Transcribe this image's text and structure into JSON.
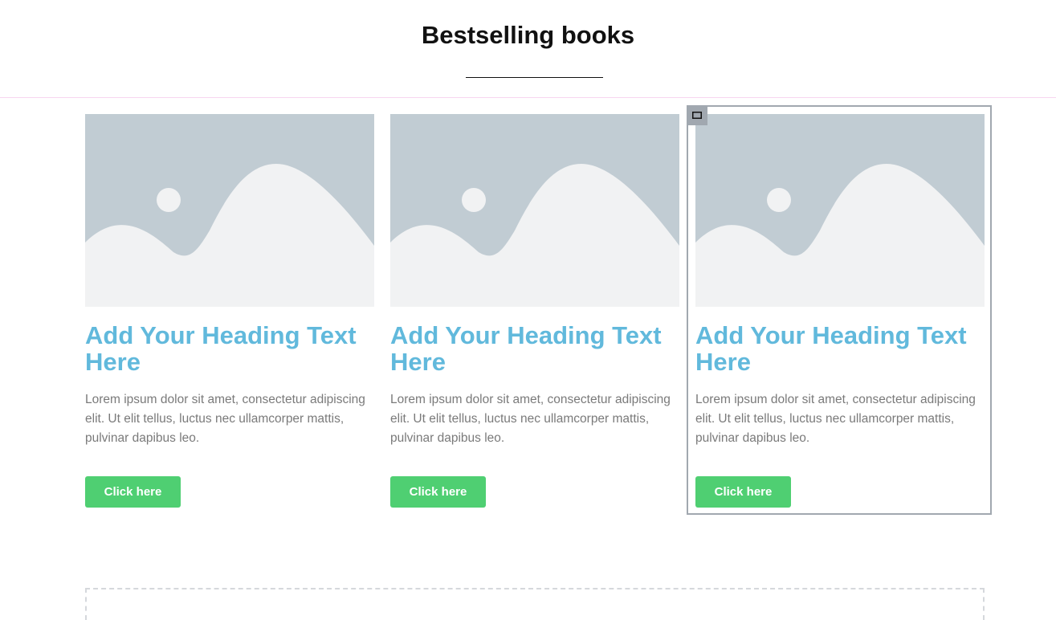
{
  "header": {
    "title": "Bestselling books"
  },
  "cards": [
    {
      "image_icon": "image-placeholder-icon",
      "heading": "Add Your Heading Text Here",
      "text": "Lorem ipsum dolor sit amet, consectetur adipiscing elit. Ut elit tellus, luctus nec ullamcorper mattis, pulvinar dapibus leo.",
      "button_label": "Click here"
    },
    {
      "image_icon": "image-placeholder-icon",
      "heading": "Add Your Heading Text Here",
      "text": "Lorem ipsum dolor sit amet, consectetur adipiscing elit. Ut elit tellus, luctus nec ullamcorper mattis, pulvinar dapibus leo.",
      "button_label": "Click here"
    },
    {
      "image_icon": "image-placeholder-icon",
      "heading": "Add Your Heading Text Here",
      "text": "Lorem ipsum dolor sit amet, consectetur adipiscing elit. Ut elit tellus, luctus nec ullamcorper mattis, pulvinar dapibus leo.",
      "button_label": "Click here"
    }
  ],
  "editor": {
    "selected_card": 3,
    "handle_icon": "column-handle-icon"
  },
  "colors": {
    "heading_accent": "#61b9dc",
    "button": "#4fcf72",
    "image_placeholder": "#c1ccd3",
    "selection_outline": "#a1a8b0"
  }
}
